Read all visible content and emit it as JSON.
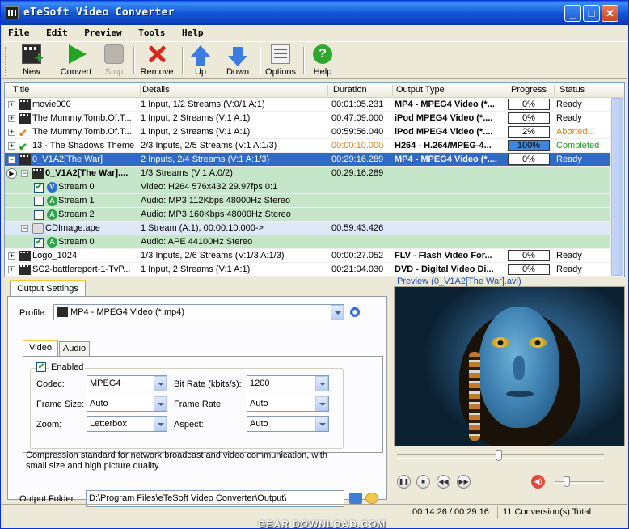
{
  "window": {
    "title": "eTeSoft Video Converter"
  },
  "menu": [
    "File",
    "Edit",
    "Preview",
    "Tools",
    "Help"
  ],
  "toolbar": {
    "new": "New",
    "convert": "Convert",
    "stop": "Stop",
    "remove": "Remove",
    "up": "Up",
    "down": "Down",
    "options": "Options",
    "help": "Help"
  },
  "filelist": {
    "columns": [
      "Title",
      "Details",
      "Duration",
      "Output Type",
      "Progress",
      "Status"
    ],
    "rows": [
      {
        "title": "movie000",
        "details": "1 Input, 1/2 Streams (V:0/1 A:1)",
        "duration": "00:01:05.231",
        "output": "MP4 - MPEG4 Video (*...",
        "progress": "0%",
        "progress_value": 0,
        "status": "Ready"
      },
      {
        "title": "The.Mummy.Tomb.Of.T...",
        "details": "1 Input, 2 Streams (V:1 A:1)",
        "duration": "00:47:09.000",
        "output": "iPod MPEG4 Video (*....",
        "progress": "0%",
        "progress_value": 0,
        "status": "Ready"
      },
      {
        "title": "The.Mummy.Tomb.Of.T...",
        "details": "1 Input, 2 Streams (V:1 A:1)",
        "duration": "00:59:56.040",
        "output": "iPod MPEG4 Video (*....",
        "progress": "2%",
        "progress_value": 2,
        "status": "Aborted..."
      },
      {
        "title": "13 - The Shadows Theme",
        "details": "2/3 Inputs, 2/5 Streams (V:1 A:1/3)",
        "duration": "00:00:10.000",
        "output": "H264 - H.264/MPEG-4...",
        "progress": "100%",
        "progress_value": 100,
        "status": "Completed"
      },
      {
        "title": "0_V1A2[The War]",
        "details": "2 Inputs, 2/4 Streams (V:1 A:1/3)",
        "duration": "00:29:16.289",
        "output": "MP4 - MPEG4 Video (*....",
        "progress": "0%",
        "progress_value": 0,
        "status": "Ready"
      },
      {
        "title": "0_V1A2[The War]....",
        "details": "1/3 Streams (V:1 A:0/2)",
        "duration": "00:29:16.289"
      },
      {
        "title": "Stream 0",
        "badge": "V",
        "details": "Video: H264 576x432 29.97fps 0:1"
      },
      {
        "title": "Stream 1",
        "badge": "A",
        "details": "Audio: MP3 112Kbps 48000Hz Stereo"
      },
      {
        "title": "Stream 2",
        "badge": "A",
        "details": "Audio: MP3 160Kbps 48000Hz Stereo"
      },
      {
        "title": "CDImage.ape",
        "details": "1 Stream (A:1), 00:00:10.000->",
        "duration": "00:59:43.426"
      },
      {
        "title": "Stream 0",
        "badge": "A",
        "details": "Audio: APE 44100Hz Stereo"
      },
      {
        "title": "Logo_1024",
        "details": "1/3 Inputs, 2/6 Streams (V:1/3 A:1/3)",
        "duration": "00:00:27.052",
        "output": "FLV - Flash Video For...",
        "progress": "0%",
        "progress_value": 0,
        "status": "Ready"
      },
      {
        "title": "SC2-battlereport-1-TvP...",
        "details": "1 Input, 2 Streams (V:1 A:1)",
        "duration": "00:21:04.030",
        "output": "DVD - Digital Video Di...",
        "progress": "0%",
        "progress_value": 0,
        "status": "Ready"
      }
    ]
  },
  "settings": {
    "tab": "Output Settings",
    "profile_label": "Profile:",
    "profile_value": "MP4 - MPEG4 Video (*.mp4)",
    "tab_video": "Video",
    "tab_audio": "Audio",
    "enabled_label": "Enabled",
    "codec_label": "Codec:",
    "codec_value": "MPEG4",
    "bitrate_label": "Bit Rate (kbits/s):",
    "bitrate_value": "1200",
    "framesize_label": "Frame Size:",
    "framesize_value": "Auto",
    "framerate_label": "Frame Rate:",
    "framerate_value": "Auto",
    "zoom_label": "Zoom:",
    "zoom_value": "Letterbox",
    "aspect_label": "Aspect:",
    "aspect_value": "Auto",
    "description": "Compression standard for network broadcast and video communication, with small size and high picture quality.",
    "folder_label": "Output Folder:",
    "folder_value": "D:\\Program Files\\eTeSoft Video Converter\\Output\\"
  },
  "preview": {
    "title": "Preview (0_V1A2[The War].avi)",
    "seek_fraction": 0.48,
    "volume_fraction": 0.2
  },
  "statusbar": {
    "time": "00:14:26 / 00:29:16",
    "total": "11 Conversion(s) Total"
  },
  "watermark": "GEAR DOWNLOAD.COM"
}
